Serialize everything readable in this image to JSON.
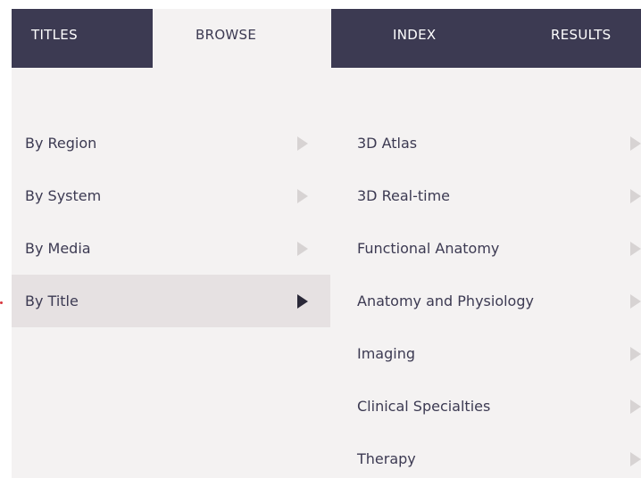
{
  "tabs": [
    {
      "label": "TITLES",
      "active": false
    },
    {
      "label": "BROWSE",
      "active": true
    },
    {
      "label": "INDEX",
      "active": false
    },
    {
      "label": "RESULTS",
      "active": false
    }
  ],
  "browse_categories": {
    "items": [
      {
        "label": "By Region",
        "selected": false
      },
      {
        "label": "By System",
        "selected": false
      },
      {
        "label": "By Media",
        "selected": false
      },
      {
        "label": "By Title",
        "selected": true
      }
    ]
  },
  "title_groups": {
    "items": [
      {
        "label": "3D Atlas"
      },
      {
        "label": "3D Real-time"
      },
      {
        "label": "Functional Anatomy"
      },
      {
        "label": "Anatomy and Physiology"
      },
      {
        "label": "Imaging"
      },
      {
        "label": "Clinical Specialties"
      },
      {
        "label": "Therapy"
      }
    ]
  },
  "colors": {
    "tab_dark": "#3c3a52",
    "panel_bg": "#f4f2f2",
    "selected_bg": "#e6e1e2",
    "text": "#3c3a52",
    "arrow_inactive": "#d7d3d3",
    "arrow_active": "#2a2838"
  }
}
